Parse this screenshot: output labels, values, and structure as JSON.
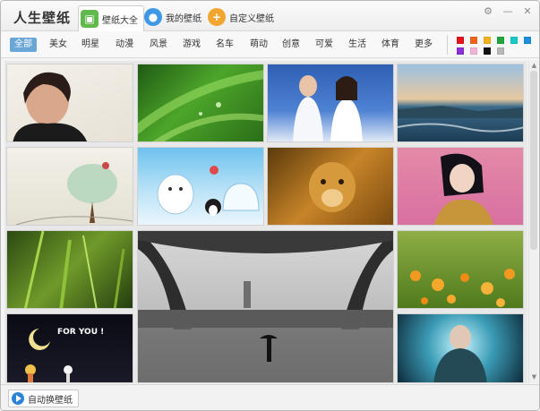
{
  "app": {
    "title": "人生壁纸"
  },
  "tabs": [
    {
      "label": "壁纸大全",
      "icon": "gallery-icon"
    },
    {
      "label": "我的壁纸",
      "icon": "user-icon"
    },
    {
      "label": "自定义壁纸",
      "icon": "plus-icon"
    }
  ],
  "window_controls": {
    "settings": "⚙",
    "minimize": "—",
    "close": "✕"
  },
  "categories": [
    "全部",
    "美女",
    "明星",
    "动漫",
    "风景",
    "游戏",
    "名车",
    "萌动",
    "创意",
    "可爱",
    "生活",
    "体育",
    "更多"
  ],
  "selected_category": "全部",
  "color_filters": [
    "#e8141b",
    "#f4651c",
    "#f4b11c",
    "#1fa83a",
    "#18c8c8",
    "#1a8fe3",
    "#8a2fd8",
    "#f1b3d5",
    "#111111",
    "#b8b8b8"
  ],
  "wallpapers": [
    {
      "subject": "male-celebrity-portrait"
    },
    {
      "subject": "green-leaves-waterdrops"
    },
    {
      "subject": "celebrity-couple-in-white"
    },
    {
      "subject": "coastline-sunset"
    },
    {
      "subject": "cartoon-tree-sketch"
    },
    {
      "subject": "polar-bear-cartoon"
    },
    {
      "subject": "lion-cub"
    },
    {
      "subject": "woman-fashion-portrait"
    },
    {
      "subject": "grass-closeup"
    },
    {
      "subject": "eiffel-tower-rain"
    },
    {
      "subject": "orange-flowers-field"
    },
    {
      "subject": "for-you-moon-night"
    },
    {
      "subject": "hooded-figure-light"
    }
  ],
  "captions": {
    "for_you": "FOR YOU !"
  },
  "footer": {
    "auto_change_label": "自动换壁纸"
  }
}
